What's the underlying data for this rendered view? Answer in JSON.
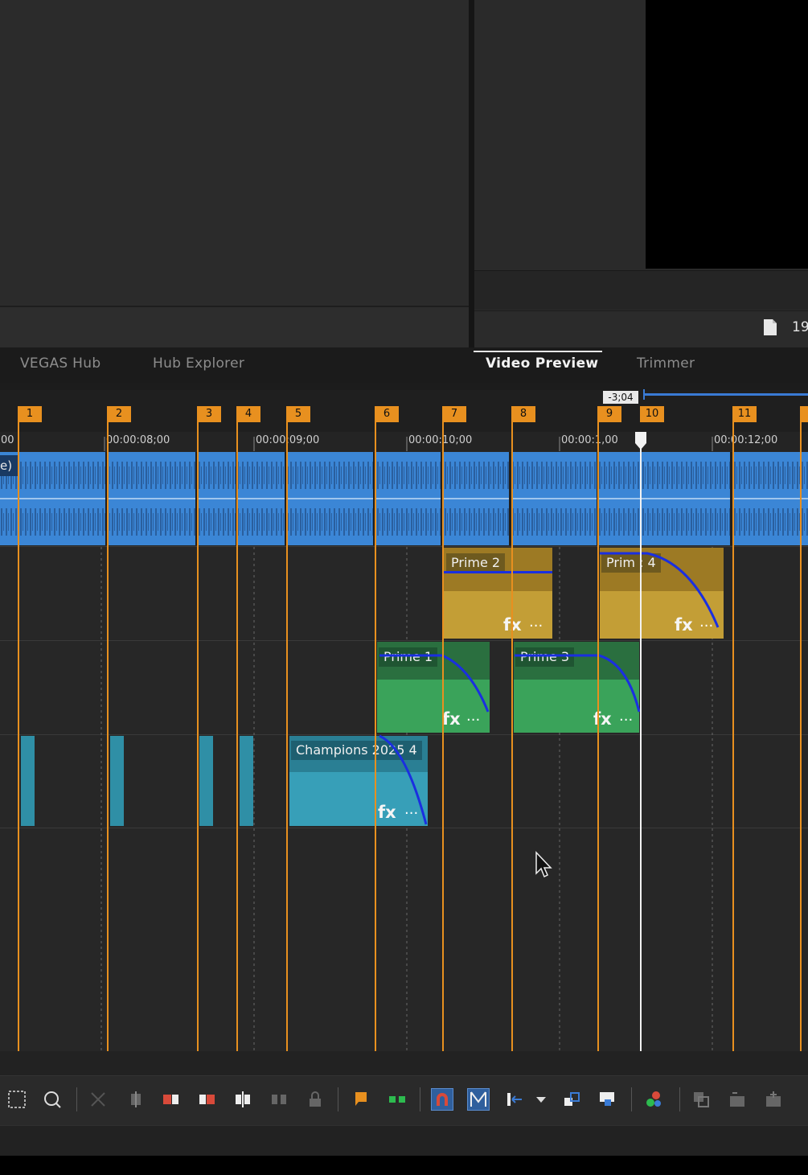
{
  "preview": {
    "resolution_text": "19"
  },
  "tabs": [
    {
      "label": "VEGAS Hub"
    },
    {
      "label": "Hub Explorer"
    },
    {
      "label": "Video Preview"
    },
    {
      "label": "Trimmer"
    }
  ],
  "timeline": {
    "cursor_readout": "-3;04",
    "markers": [
      "1",
      "2",
      "3",
      "4",
      "5",
      "6",
      "7",
      "8",
      "9",
      "10",
      "11"
    ],
    "ruler": [
      "00",
      "00:00:08;00",
      "00:00:09;00",
      "00:00:10;00",
      "00:00:11;00",
      "00:00:12;00"
    ],
    "ruler_display": [
      "00",
      "00:00:08;00",
      "00:00:09;00",
      "00:00:10;00",
      "00:00:1,00",
      "00:00:12;00"
    ],
    "track1_label_fragment": "e)",
    "clips": {
      "prime2": "Prime 2",
      "prime4": "Prim : 4",
      "prime1": "Prime 1",
      "prime3": "Prime 3",
      "champions": "Champions 2025 4"
    },
    "fx_label": "fx",
    "more_label": "···"
  },
  "colors": {
    "marker": "#e8901f",
    "track1_audio": "#3b86d6",
    "prime_yellow": "#b8922c",
    "prime_green": "#2f8a4b",
    "champions_cyan": "#3ba7c0",
    "fade_curve": "#1a2fe0",
    "toolbar_active": "#2f5f9d"
  }
}
